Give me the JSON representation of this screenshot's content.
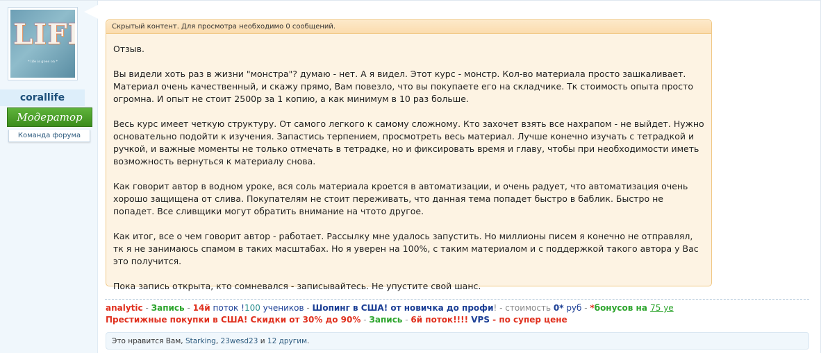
{
  "user": {
    "avatar_text": "LIFE",
    "avatar_tagline": "* life is goes on *",
    "username": "corallife",
    "role": "Модератор",
    "team": "Команда форума"
  },
  "hidden_content": {
    "header": "Скрытый контент. Для просмотра необходимо 0 сообщений.",
    "paragraphs": [
      "Отзыв.",
      "Вы видели хоть раз в жизни \"монстра\"? думаю - нет. А я видел. Этот курс - монстр. Кол-во материала просто зашкаливает. Материал очень качественный, и скажу прямо, Вам повезло, что вы покупаете его на складчике. Тк стоимость опыта просто огромна. И опыт не стоит 2500р за 1 копию, а как минимум в 10 раз больше.",
      "Весь курс имеет четкую структуру. От самого легкого к самому сложному. Кто захочет взять все нахрапом - не выйдет. Нужно основательно подойти к изучения. Запастись терпением, просмотреть весь материал. Лучше конечно изучать с тетрадкой и ручкой, и важные моменты не только отмечать в тетрадке, но и фиксировать время и главу, чтобы при необходимости иметь возможность вернуться к материалу снова.",
      "Как говорит автор в водном уроке, вся соль материала кроется в автоматизации, и очень радует, что автоматизация очень хорошо защищена от слива. Покупателям не стоит переживать, что данная тема попадет быстро в баблик. Быстро не попадет. Все сливщики могут обратить внимание на чтото другое.",
      "Как итог, все о чем говорит автор - работает. Рассылку мне удалось запустить. Но миллионы писем я конечно не отправлял, тк я не занимаюсь спамом в таких масштабах. Но я уверен на 100%, с таким материалом и с поддержкой такого автора у Вас это получится.",
      "Пока запись открыта, кто сомневался - записывайтесь. Не упустите свой шанс."
    ]
  },
  "signature": {
    "line1": {
      "a": "analytic",
      "b": " - ",
      "c": "Запись",
      "d": " - ",
      "e": "14й",
      "f": " поток !",
      "g": "100",
      "h": " учеников",
      "i": " - ",
      "j": "Шопинг в США! от новичка до профи",
      "k": "! - стоимость ",
      "l": "0*",
      "m": " руб",
      "n": " - ",
      "o": "*",
      "p": "бонусов на ",
      "q": "75 уе"
    },
    "line2": {
      "a": "Престижные покупки в США! Скидки от 30% до 90%",
      "b": " - ",
      "c": "Запись",
      "d": " - ",
      "e": "6й поток!!!!",
      "f": " VPS",
      "g": " - по супер цене"
    }
  },
  "likes": {
    "prefix": "Это нравится Вам, ",
    "user1": "Starking",
    "sep": ", ",
    "user2": "23wesd23",
    "and": " и ",
    "others": "12 другим",
    "end": "."
  }
}
